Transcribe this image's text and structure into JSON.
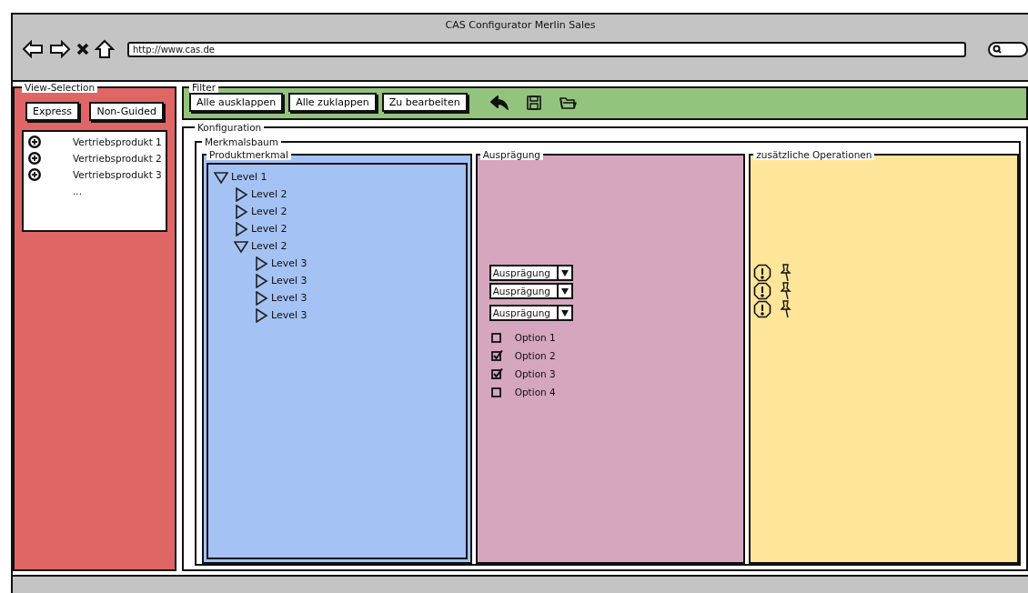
{
  "window": {
    "title": "CAS Configurator Merlin Sales"
  },
  "browser": {
    "url": "http://www.cas.de"
  },
  "view_selection": {
    "legend": "View-Selection",
    "buttons": [
      "Express",
      "Non-Guided"
    ],
    "items": [
      {
        "kind": "product",
        "label": "Vertriebsprodukt 1"
      },
      {
        "kind": "product",
        "label": "Vertriebsprodukt 2"
      },
      {
        "kind": "product",
        "label": "Vertriebsprodukt 3"
      },
      {
        "kind": "more",
        "label": "..."
      }
    ]
  },
  "filter": {
    "legend": "Filter",
    "buttons": [
      "Alle ausklappen",
      "Alle zuklappen",
      "Zu bearbeiten"
    ],
    "tools": [
      {
        "kind": "undo"
      },
      {
        "kind": "save"
      },
      {
        "kind": "open"
      }
    ]
  },
  "konfiguration": {
    "legend": "Konfiguration",
    "merkmalsbaum": {
      "legend": "Merkmalsbaum",
      "produktmerkmal": {
        "legend": "Produktmerkmal",
        "tree": [
          {
            "label": "Level 1",
            "expanded": true,
            "children": [
              {
                "label": "Level 2",
                "expanded": false
              },
              {
                "label": "Level 2",
                "expanded": false
              },
              {
                "label": "Level 2",
                "expanded": false
              },
              {
                "label": "Level 2",
                "expanded": true,
                "children": [
                  {
                    "label": "Level 3",
                    "expanded": false
                  },
                  {
                    "label": "Level 3",
                    "expanded": false
                  },
                  {
                    "label": "Level 3",
                    "expanded": false
                  },
                  {
                    "label": "Level 3",
                    "expanded": false
                  }
                ]
              }
            ]
          }
        ]
      },
      "auspraegung": {
        "legend": "Ausprägung",
        "dropdowns": [
          "Ausprägung",
          "Ausprägung",
          "Ausprägung"
        ],
        "options": [
          {
            "label": "Option 1",
            "checked": false
          },
          {
            "label": "Option 2",
            "checked": true
          },
          {
            "label": "Option 3",
            "checked": true
          },
          {
            "label": "Option 4",
            "checked": false
          }
        ]
      },
      "operationen": {
        "legend": "zusätzliche Operationen",
        "rows": [
          {
            "kind": "warning-pin"
          },
          {
            "kind": "warning-pin"
          },
          {
            "kind": "warning-pin"
          }
        ]
      }
    }
  }
}
